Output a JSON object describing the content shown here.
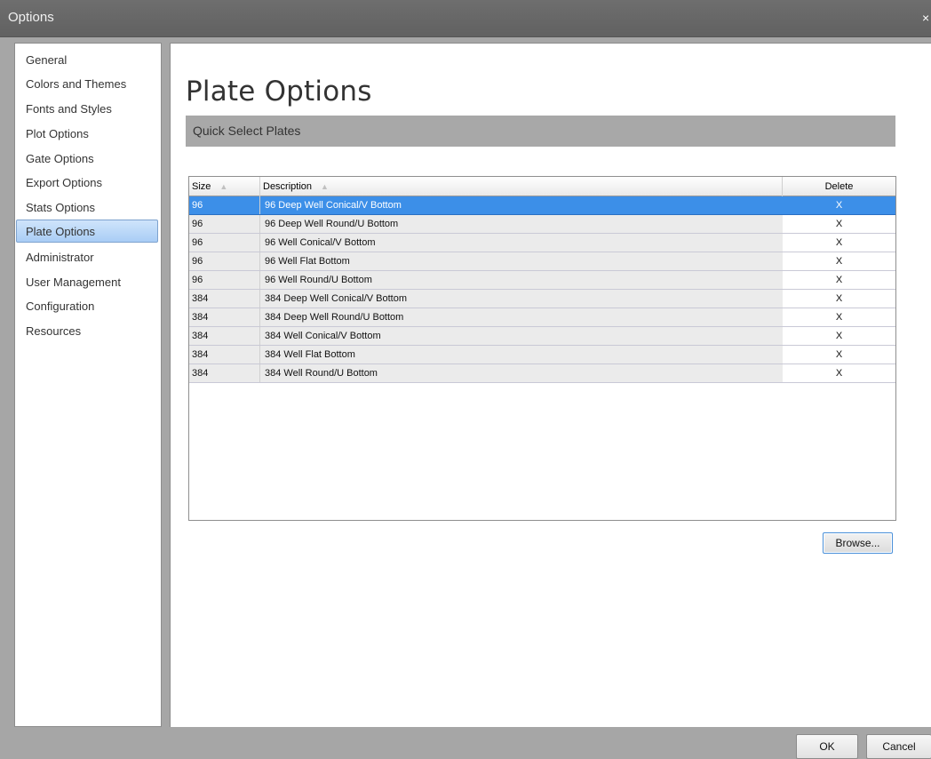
{
  "window": {
    "title": "Options",
    "close_glyph": "×"
  },
  "sidebar": {
    "items": [
      {
        "label": "General"
      },
      {
        "label": "Colors and Themes"
      },
      {
        "label": "Fonts and Styles"
      },
      {
        "label": "Plot Options"
      },
      {
        "label": "Gate Options"
      },
      {
        "label": "Export Options"
      },
      {
        "label": "Stats Options"
      },
      {
        "label": "Plate Options",
        "selected": true
      },
      {
        "label": "Administrator"
      },
      {
        "label": "User Management"
      },
      {
        "label": "Configuration"
      },
      {
        "label": "Resources"
      }
    ]
  },
  "main": {
    "title": "Plate Options",
    "section_header": "Quick Select Plates",
    "grid": {
      "columns": {
        "size": "Size",
        "description": "Description",
        "delete": "Delete"
      },
      "sort_glyph": "▲",
      "rows": [
        {
          "size": "96",
          "description": "96 Deep Well Conical/V Bottom",
          "delete": "X",
          "selected": true
        },
        {
          "size": "96",
          "description": "96 Deep Well Round/U Bottom",
          "delete": "X"
        },
        {
          "size": "96",
          "description": "96 Well Conical/V Bottom",
          "delete": "X"
        },
        {
          "size": "96",
          "description": "96 Well Flat Bottom",
          "delete": "X"
        },
        {
          "size": "96",
          "description": "96 Well Round/U Bottom",
          "delete": "X"
        },
        {
          "size": "384",
          "description": "384 Deep Well Conical/V Bottom",
          "delete": "X"
        },
        {
          "size": "384",
          "description": "384 Deep Well Round/U Bottom",
          "delete": "X"
        },
        {
          "size": "384",
          "description": "384 Well Conical/V Bottom",
          "delete": "X"
        },
        {
          "size": "384",
          "description": "384 Well Flat Bottom",
          "delete": "X"
        },
        {
          "size": "384",
          "description": "384 Well Round/U Bottom",
          "delete": "X"
        }
      ]
    },
    "browse_label": "Browse..."
  },
  "footer": {
    "ok_label": "OK",
    "cancel_label": "Cancel"
  },
  "colors": {
    "selection": "#3c8fe8",
    "section_header_bg": "#a8a8a8",
    "titlebar_bg": "#666666"
  }
}
